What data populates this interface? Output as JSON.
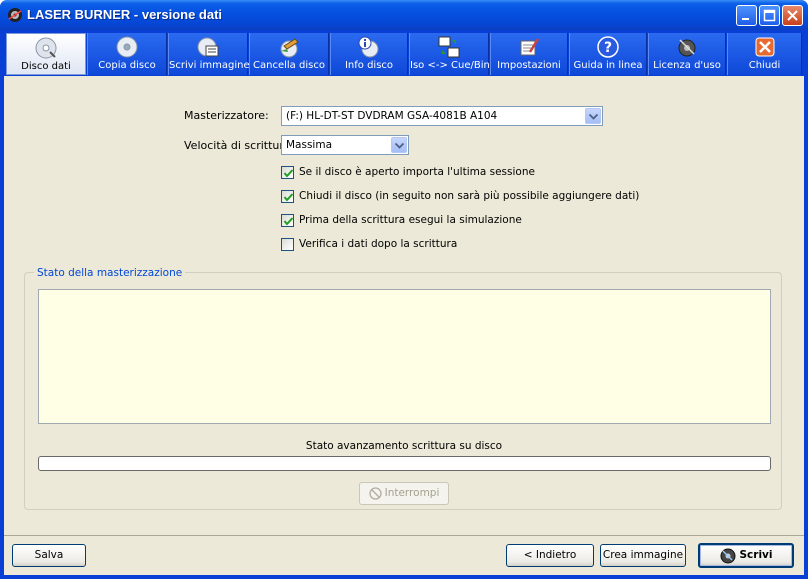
{
  "window": {
    "title": "LASER BURNER - versione dati"
  },
  "toolbar": {
    "items": [
      {
        "label": "Disco dati",
        "icon": "data-disc-icon",
        "active": true
      },
      {
        "label": "Copia disco",
        "icon": "copy-disc-icon"
      },
      {
        "label": "Scrivi immagine",
        "icon": "write-image-icon"
      },
      {
        "label": "Cancella disco",
        "icon": "erase-disc-icon"
      },
      {
        "label": "Info disco",
        "icon": "disc-info-icon"
      },
      {
        "label": "Iso <-> Cue/Bin",
        "icon": "iso-convert-icon"
      },
      {
        "label": "Impostazioni",
        "icon": "settings-icon"
      },
      {
        "label": "Guida in linea",
        "icon": "help-icon"
      },
      {
        "label": "Licenza d'uso",
        "icon": "license-icon"
      },
      {
        "label": "Chiudi",
        "icon": "close-icon"
      }
    ]
  },
  "form": {
    "burner_label": "Masterizzatore:",
    "burner_value": "(F:) HL-DT-ST DVDRAM GSA-4081B A104",
    "speed_label": "Velocità di scrittura:",
    "speed_value": "Massima"
  },
  "options": [
    {
      "label": "Se il disco è aperto importa l'ultima sessione",
      "checked": true
    },
    {
      "label": "Chiudi il disco (in seguito non sarà più possibile aggiungere dati)",
      "checked": true
    },
    {
      "label": "Prima della scrittura esegui la simulazione",
      "checked": true
    },
    {
      "label": "Verifica i dati dopo la scrittura",
      "checked": false
    }
  ],
  "status": {
    "group_title": "Stato della masterizzazione",
    "progress_label": "Stato avanzamento scrittura su disco",
    "progress": 0,
    "interrupt_label": "Interrompi"
  },
  "footer": {
    "save_label": "Salva",
    "back_label": "< Indietro",
    "create_image_label": "Crea immagine",
    "write_label": "Scrivi"
  },
  "colors": {
    "titlebar": "#0550e0",
    "workspace": "#ece9d8",
    "log_bg": "#ffffe6",
    "group_title": "#0046d5"
  }
}
